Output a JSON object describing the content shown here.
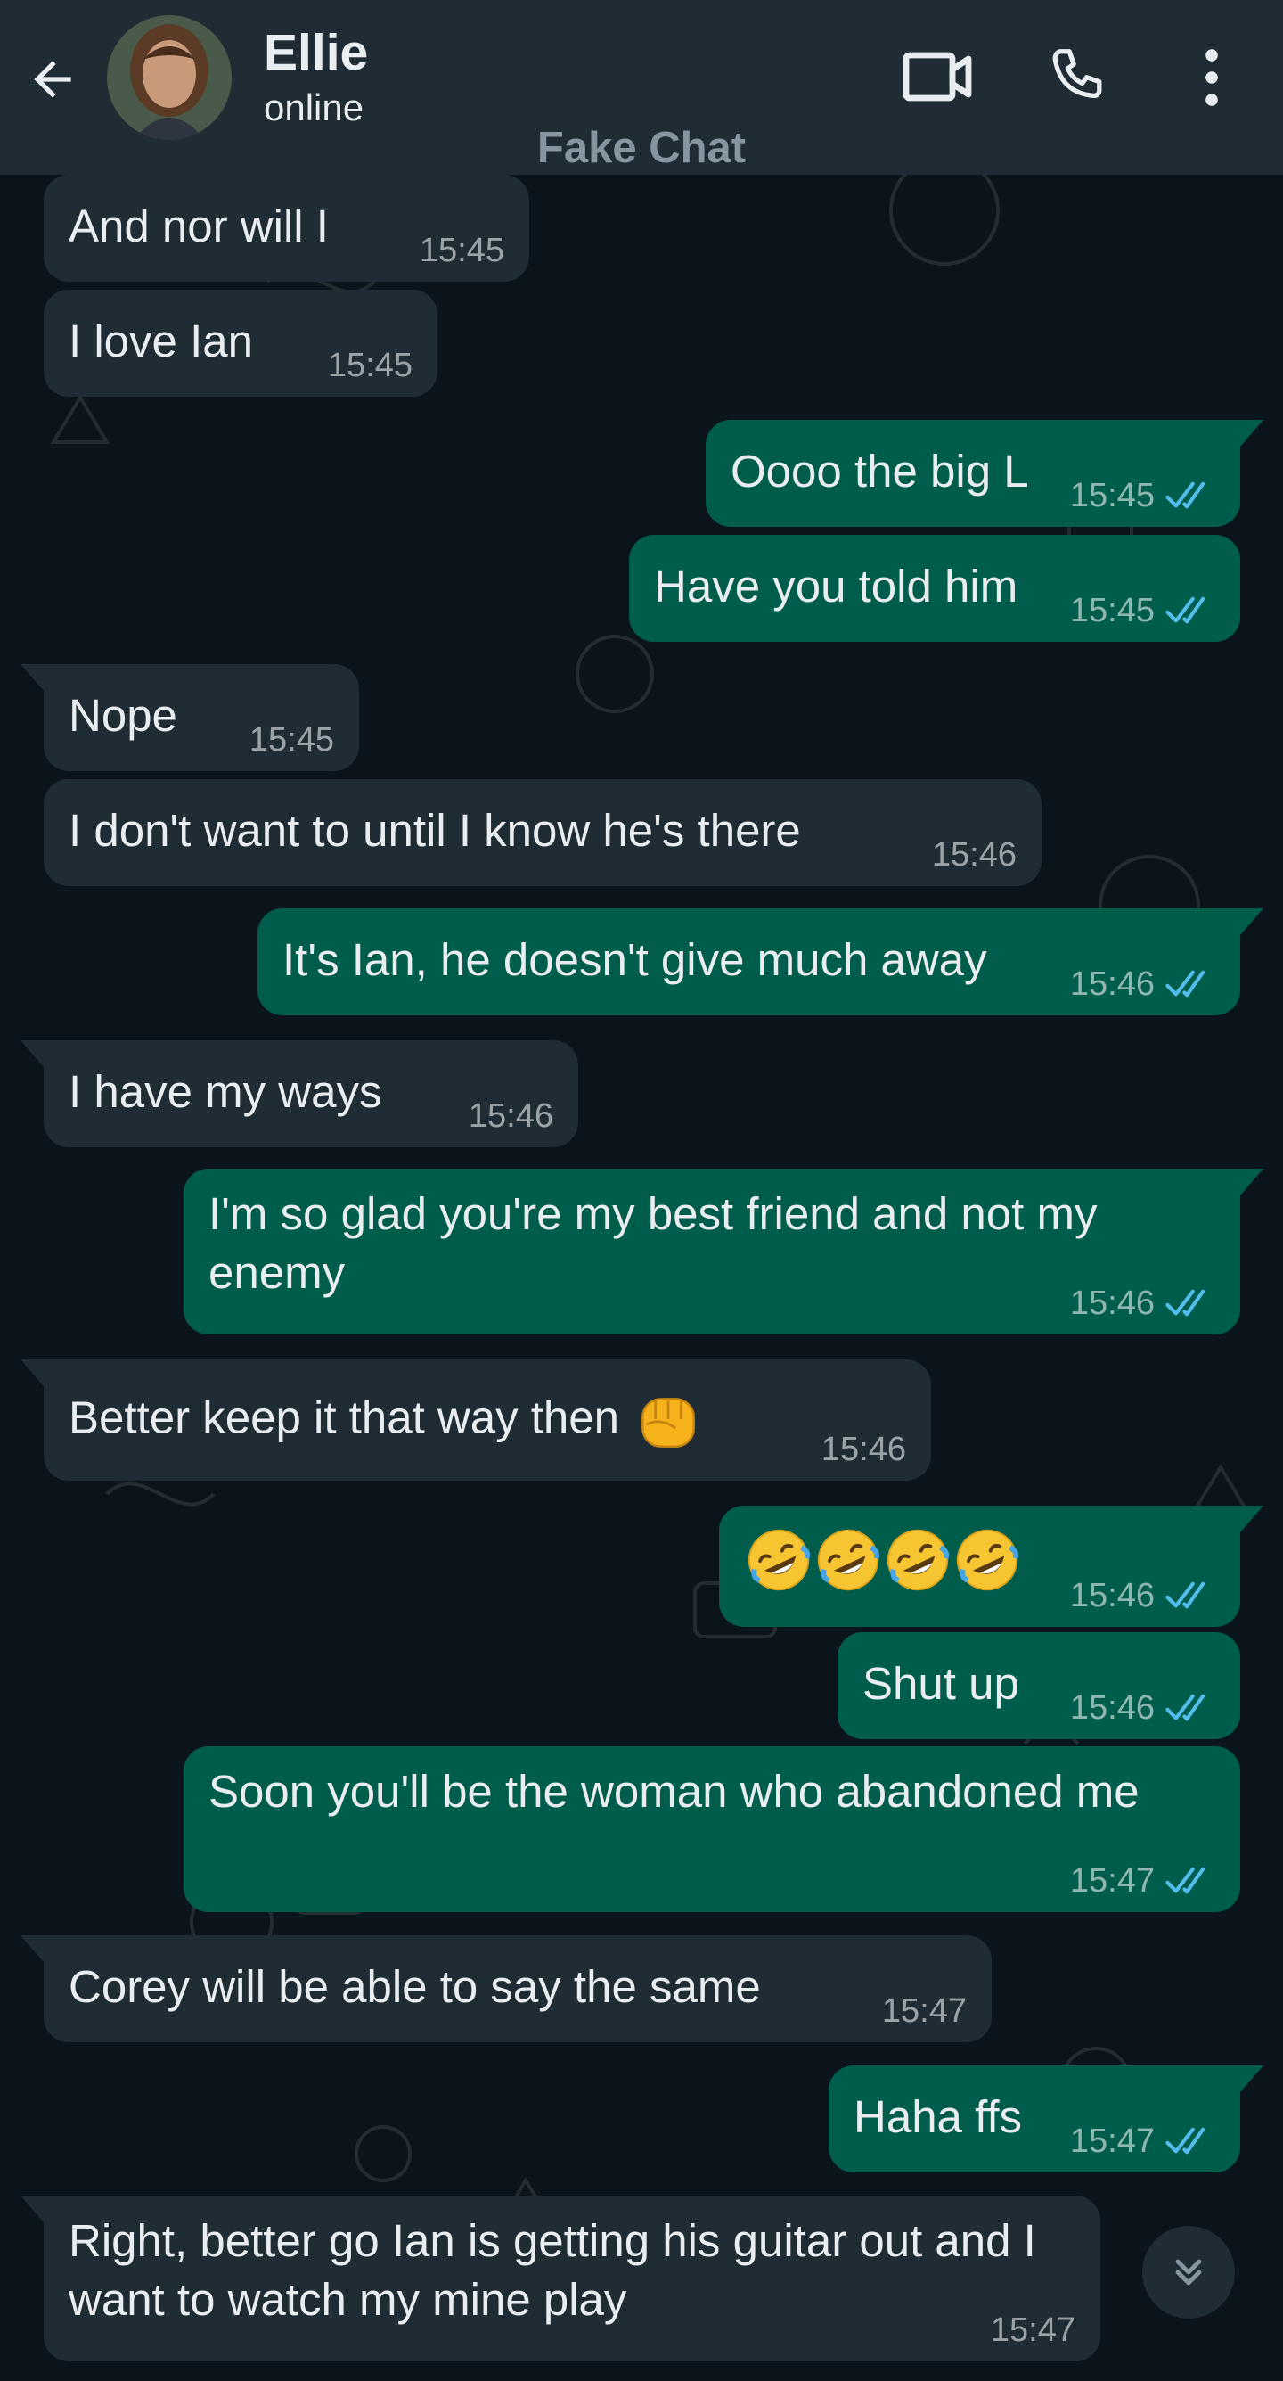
{
  "header": {
    "contact_name": "Ellie",
    "contact_status": "online",
    "watermark": "Fake Chat",
    "icons": [
      "back-arrow-icon",
      "video-call-icon",
      "phone-icon",
      "more-options-icon"
    ]
  },
  "colors": {
    "header_bg": "#1f2c34",
    "chat_bg": "#0b141a",
    "incoming_bubble": "#1f2c34",
    "outgoing_bubble": "#005c4b",
    "read_ticks": "#53bdeb"
  },
  "messages": [
    {
      "dir": "in",
      "text": "And nor will I",
      "time": "15:45"
    },
    {
      "dir": "in",
      "text": "I love Ian",
      "time": "15:45"
    },
    {
      "dir": "out",
      "text": "Oooo the big L",
      "time": "15:45",
      "status": "read"
    },
    {
      "dir": "out",
      "text": "Have you told him",
      "time": "15:45",
      "status": "read"
    },
    {
      "dir": "in",
      "text": "Nope",
      "time": "15:45"
    },
    {
      "dir": "in",
      "text": "I don't want to until I know he's there",
      "time": "15:46"
    },
    {
      "dir": "out",
      "text": "It's Ian, he doesn't give much away",
      "time": "15:46",
      "status": "read"
    },
    {
      "dir": "in",
      "text": "I have my ways",
      "time": "15:46"
    },
    {
      "dir": "out",
      "text": "I'm so glad you're my best friend and not my enemy",
      "time": "15:46",
      "status": "read"
    },
    {
      "dir": "in",
      "text": "Better keep it that way then",
      "emoji": "oncoming-fist-emoji",
      "time": "15:46"
    },
    {
      "dir": "out",
      "text": "",
      "emoji": "rolling-on-floor-laughing-emoji",
      "emoji_count": 4,
      "time": "15:46",
      "status": "read"
    },
    {
      "dir": "out",
      "text": "Shut up",
      "time": "15:46",
      "status": "read"
    },
    {
      "dir": "out",
      "text": "Soon you'll be the woman who abandoned me",
      "time": "15:47",
      "status": "read"
    },
    {
      "dir": "in",
      "text": "Corey will be able to say the same",
      "time": "15:47"
    },
    {
      "dir": "out",
      "text": "Haha ffs",
      "time": "15:47",
      "status": "read"
    },
    {
      "dir": "in",
      "text": "Right, better go Ian is getting his guitar out and I want to watch my mine play",
      "time": "15:47"
    }
  ],
  "scroll_button": {
    "icon": "double-chevron-down-icon"
  }
}
